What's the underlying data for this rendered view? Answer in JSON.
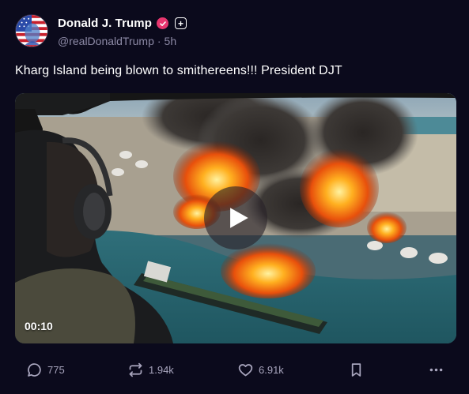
{
  "author": {
    "display_name": "Donald J. Trump",
    "handle": "@realDonaldTrump",
    "separator": "·",
    "time_ago": "5h",
    "verified_icon": "check-badge-icon",
    "follow_icon": "plus-icon"
  },
  "post": {
    "text": "Kharg Island being blown to smithereens!!! President DJT"
  },
  "media": {
    "type": "video",
    "duration": "00:10",
    "play_icon": "play-icon"
  },
  "actions": {
    "reply_count": "775",
    "repost_count": "1.94k",
    "like_count": "6.91k",
    "bookmark_icon": "bookmark-icon",
    "more_icon": "more-horizontal-icon"
  },
  "colors": {
    "background": "#0b0a1c",
    "text_primary": "#ffffff",
    "text_secondary": "#8d8aa6",
    "action_icon": "#a8a5bd",
    "verified_badge": "#e8366f"
  }
}
